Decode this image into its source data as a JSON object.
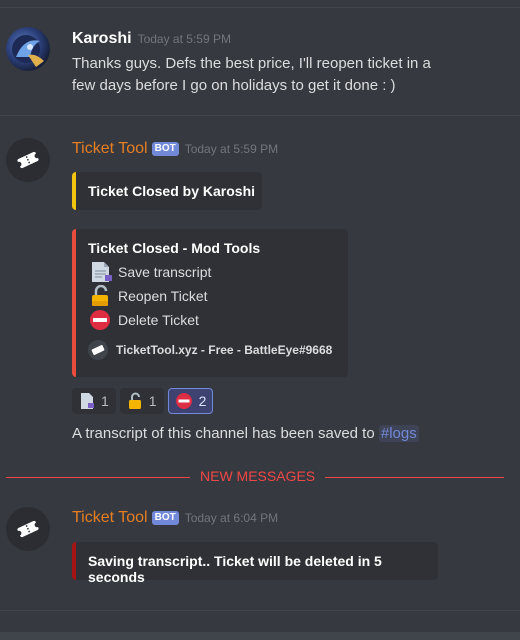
{
  "messages": {
    "first": {
      "username": "Karoshi",
      "timestamp": "Today at 5:59 PM",
      "line1": "Thanks guys. Defs the best price, I'll reopen ticket in a",
      "line2": "few days before I go on holidays to get it done : )"
    },
    "second": {
      "username": "Ticket Tool",
      "bot_tag": "BOT",
      "timestamp": "Today at 5:59 PM",
      "embed_closed": {
        "title": "Ticket Closed by Karoshi",
        "accent": "#f1c40f"
      },
      "embed_tools": {
        "title": "Ticket Closed - Mod Tools",
        "accent": "#e74c3c",
        "options": [
          {
            "icon": "document-icon",
            "label": "Save transcript"
          },
          {
            "icon": "unlock-icon",
            "label": "Reopen Ticket"
          },
          {
            "icon": "no-entry-icon",
            "label": "Delete Ticket"
          }
        ],
        "footer": "TicketTool.xyz - Free - BattleEye#9668"
      },
      "reactions": [
        {
          "icon": "document-icon",
          "count": "1"
        },
        {
          "icon": "unlock-icon",
          "count": "1"
        },
        {
          "icon": "no-entry-icon",
          "count": "2"
        }
      ],
      "transcript_text": "A transcript of this channel has been saved to ",
      "channel_mention": "#logs"
    },
    "third": {
      "username": "Ticket Tool",
      "bot_tag": "BOT",
      "timestamp": "Today at 6:04 PM",
      "embed_saving": {
        "title": "Saving transcript.. Ticket will be deleted in 5 seconds",
        "accent": "#a51414"
      }
    }
  },
  "new_messages_label": "NEW MESSAGES",
  "colors": {
    "background": "#36393f",
    "bot_name": "#e67e22",
    "new_messages": "#f04747",
    "mention": "#7289da"
  }
}
